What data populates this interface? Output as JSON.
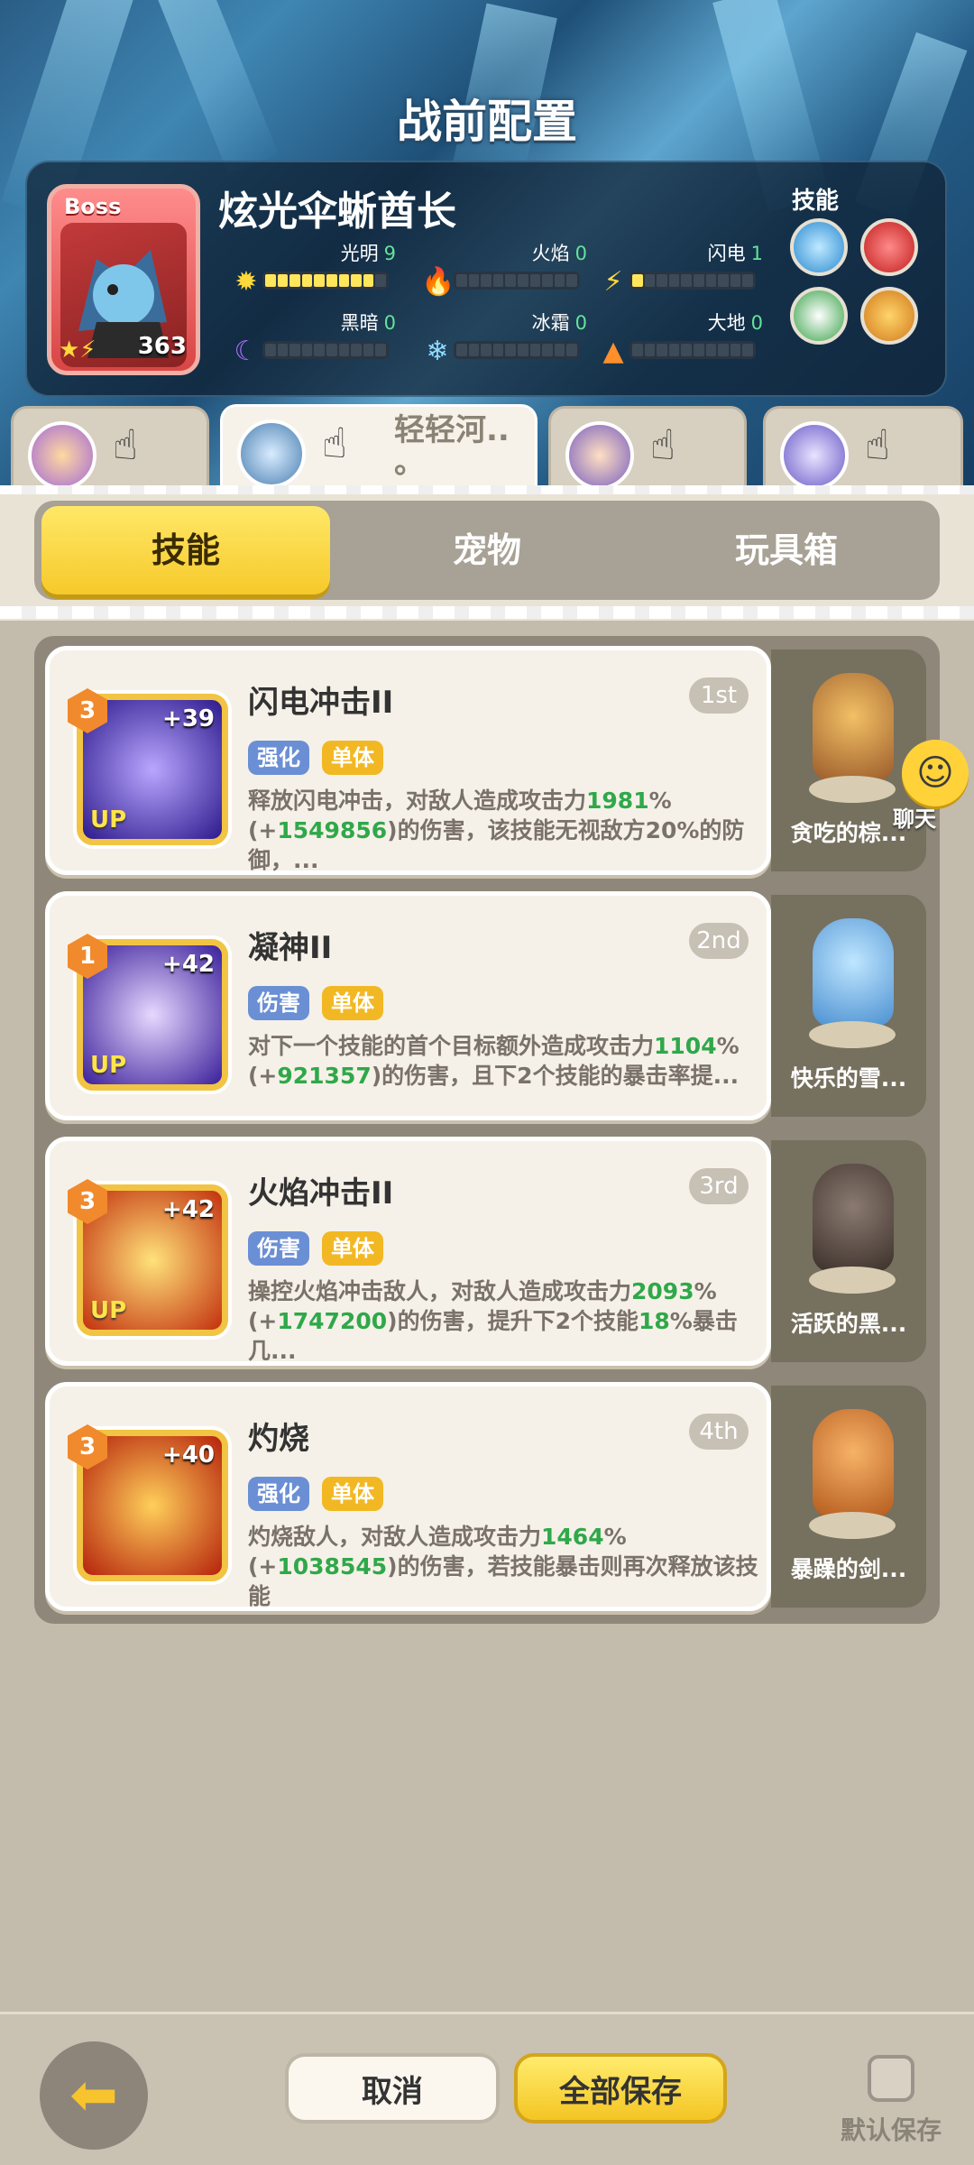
{
  "header": {
    "title": "战前配置"
  },
  "boss": {
    "tag": "Boss",
    "level": "363",
    "name": "炫光伞蜥酋长",
    "skills_label": "技能",
    "elements": [
      {
        "label": "光明",
        "value": "9",
        "fill": 9
      },
      {
        "label": "火焰",
        "value": "0",
        "fill": 0
      },
      {
        "label": "闪电",
        "value": "1",
        "fill": 1
      },
      {
        "label": "黑暗",
        "value": "0",
        "fill": 0
      },
      {
        "label": "冰霜",
        "value": "0",
        "fill": 0
      },
      {
        "label": "大地",
        "value": "0",
        "fill": 0
      }
    ]
  },
  "heroes": [
    {
      "name": ""
    },
    {
      "name": "轻轻河..\n。"
    },
    {
      "name": ""
    },
    {
      "name": ""
    }
  ],
  "tabs": [
    "技能",
    "宠物",
    "玩具箱"
  ],
  "skills": [
    {
      "level": "3",
      "bonus": "+39",
      "up": "UP",
      "name": "闪电冲击II",
      "rank": "1st",
      "tags": [
        "强化",
        "单体"
      ],
      "desc_parts": [
        "释放闪电冲击，对敌人造成攻击力",
        "1981",
        "%(+",
        "1549856",
        ")的伤害，该技能无视敌方20%的防御，..."
      ]
    },
    {
      "level": "1",
      "bonus": "+42",
      "up": "UP",
      "name": "凝神II",
      "rank": "2nd",
      "tags": [
        "伤害",
        "单体"
      ],
      "desc_parts": [
        "对下一个技能的首个目标额外造成攻击力",
        "1104",
        "%(+",
        "921357",
        ")的伤害，且下2个技能的暴击率提..."
      ]
    },
    {
      "level": "3",
      "bonus": "+42",
      "up": "UP",
      "name": "火焰冲击II",
      "rank": "3rd",
      "tags": [
        "伤害",
        "单体"
      ],
      "desc_parts": [
        "操控火焰冲击敌人，对敌人造成攻击力",
        "2093",
        "%(+",
        "1747200",
        ")的伤害，提升下2个技能",
        "18",
        "%暴击几..."
      ]
    },
    {
      "level": "3",
      "bonus": "+40",
      "up": "",
      "name": "灼烧",
      "rank": "4th",
      "tags": [
        "强化",
        "单体"
      ],
      "desc_parts": [
        "灼烧敌人，对敌人造成攻击力",
        "1464",
        "%(+",
        "1038545",
        ")的伤害，若技能暴击则再次释放该技能"
      ]
    }
  ],
  "pets": [
    {
      "name": "贪吃的棕..."
    },
    {
      "name": "快乐的雪..."
    },
    {
      "name": "活跃的黑..."
    },
    {
      "name": "暴躁的剑..."
    }
  ],
  "chat": {
    "label": "聊天"
  },
  "footer": {
    "cancel": "取消",
    "save_all": "全部保存",
    "default_save": "默认保存"
  },
  "colors": {
    "accent_yellow": "#f6c92a",
    "highlight_green": "#2fa84a",
    "chip_blue": "#6b8fd4",
    "chip_yellow": "#f2b824"
  }
}
